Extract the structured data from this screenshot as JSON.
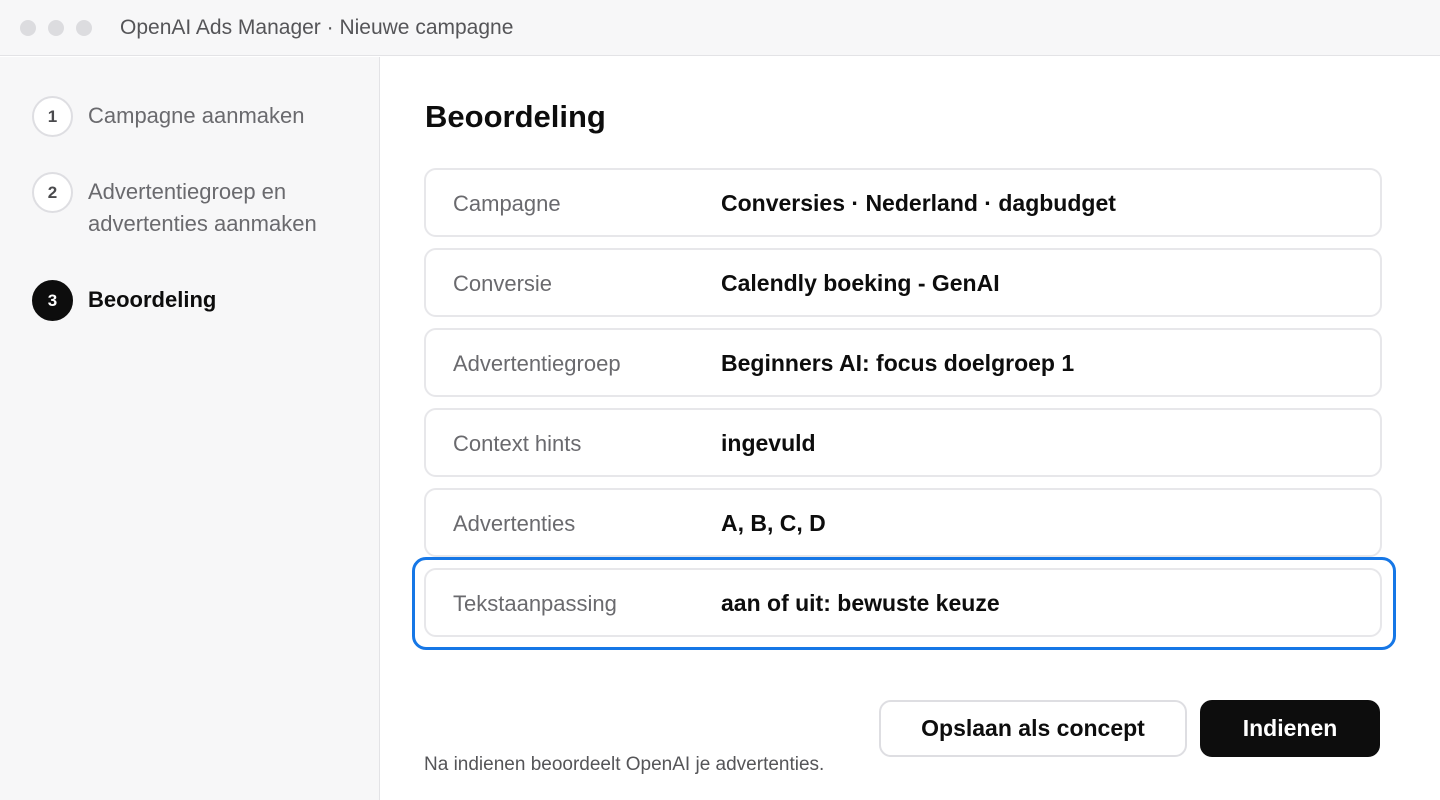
{
  "window": {
    "title": "OpenAI Ads Manager · Nieuwe campagne"
  },
  "sidebar": {
    "steps": [
      {
        "number": "1",
        "label": "Campagne aanmaken",
        "active": false
      },
      {
        "number": "2",
        "label": "Advertentiegroep en advertenties aanmaken",
        "active": false
      },
      {
        "number": "3",
        "label": "Beoordeling",
        "active": true
      }
    ]
  },
  "main": {
    "title": "Beoordeling",
    "rows": [
      {
        "label": "Campagne",
        "value": "Conversies · Nederland · dagbudget"
      },
      {
        "label": "Conversie",
        "value": "Calendly boeking - GenAI"
      },
      {
        "label": "Advertentiegroep",
        "value": "Beginners AI: focus doelgroep 1"
      },
      {
        "label": "Context hints",
        "value": "ingevuld"
      },
      {
        "label": "Advertenties",
        "value": "A, B, C, D"
      },
      {
        "label": "Tekstaanpassing",
        "value": "aan of uit: bewuste keuze",
        "focused": true
      }
    ],
    "buttons": {
      "save_draft": "Opslaan als concept",
      "submit": "Indienen"
    },
    "footnote": "Na indienen beoordeelt OpenAI je advertenties."
  },
  "colors": {
    "accent_focus": "#1677e6",
    "primary_button": "#0d0d0d",
    "sidebar_bg": "#f7f7f8"
  }
}
